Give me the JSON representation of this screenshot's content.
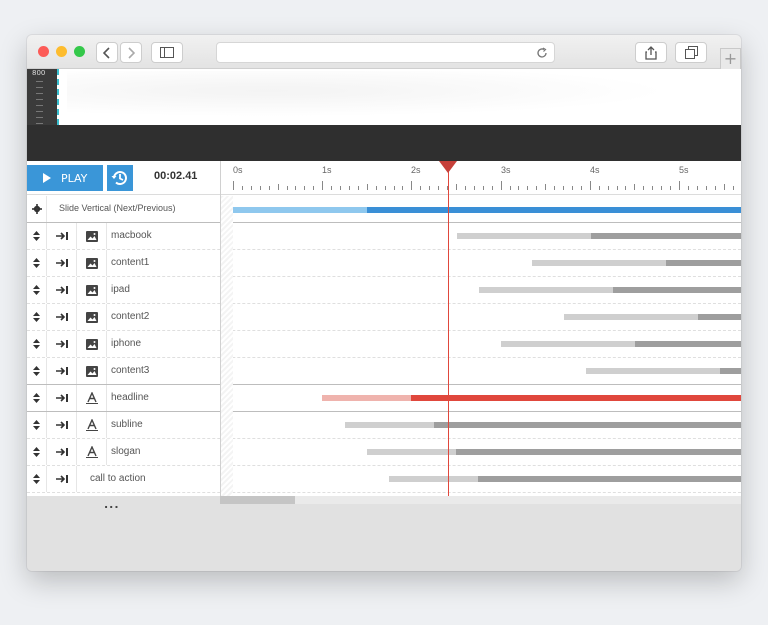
{
  "browser": {
    "url": "",
    "traffic_lights": [
      "#fc5b57",
      "#fdbc2e",
      "#34c84a"
    ],
    "newtab_label": "+"
  },
  "preview": {
    "ruler_label": "800"
  },
  "controls": {
    "play_label": "PLAY",
    "time": "00:02.41",
    "accent": "#3a96d8"
  },
  "timeline": {
    "seconds": [
      "0s",
      "1s",
      "2s",
      "3s",
      "4s",
      "5s"
    ],
    "playhead_time_s": 2.41
  },
  "slide": {
    "label": "Slide Vertical (Next/Previous)"
  },
  "layers": [
    {
      "name": "macbook",
      "icon": "image-icon"
    },
    {
      "name": "content1",
      "icon": "image-icon"
    },
    {
      "name": "ipad",
      "icon": "image-icon"
    },
    {
      "name": "content2",
      "icon": "image-icon"
    },
    {
      "name": "iphone",
      "icon": "image-icon"
    },
    {
      "name": "content3",
      "icon": "image-icon"
    },
    {
      "name": "headline",
      "icon": "text-icon"
    },
    {
      "name": "subline",
      "icon": "text-icon"
    },
    {
      "name": "slogan",
      "icon": "text-icon"
    },
    {
      "name": "call to action",
      "icon": ""
    }
  ],
  "footer": {
    "more_label": "..."
  }
}
